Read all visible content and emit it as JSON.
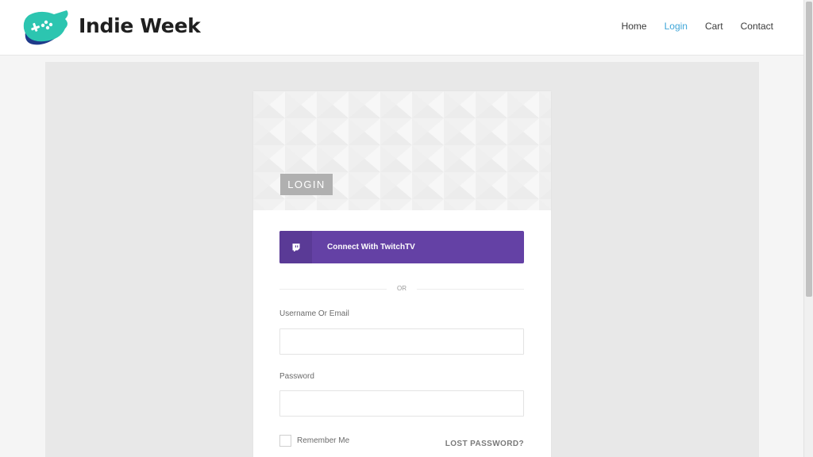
{
  "header": {
    "brand": "Indie Week",
    "nav": [
      {
        "label": "Home"
      },
      {
        "label": "Login",
        "active": true
      },
      {
        "label": "Cart"
      },
      {
        "label": "Contact"
      }
    ]
  },
  "login_card": {
    "title": "LOGIN",
    "twitch_button": "Connect With TwitchTV",
    "separator": "OR",
    "username_label": "Username Or Email",
    "username_value": "",
    "password_label": "Password",
    "password_value": "",
    "remember_label": "Remember Me",
    "lost_password": "LOST PASSWORD?"
  },
  "colors": {
    "twitch_purple": "#6441a5",
    "nav_active": "#3fa6d8",
    "logo_teal": "#2cc5b0",
    "logo_navy": "#1f3a8a"
  },
  "icons": {
    "logo": "gamepad-logo-icon",
    "twitch": "twitch-icon"
  }
}
